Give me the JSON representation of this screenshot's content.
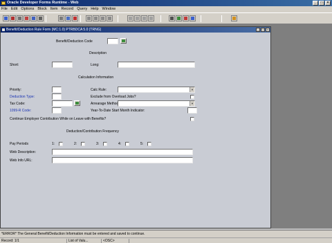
{
  "window": {
    "title": "Oracle Developer Forms Runtime - Web",
    "controls": [
      "_",
      "□",
      "×"
    ]
  },
  "menu": {
    "items": [
      "File",
      "Edit",
      "Options",
      "Block",
      "Item",
      "Record",
      "Query",
      "Help",
      "Window"
    ]
  },
  "toolbar": {
    "buttons": [
      {
        "icon": "save-icon",
        "color": "#3a5fcd"
      },
      {
        "icon": "exit-icon",
        "color": "#b03030"
      },
      {
        "icon": "print-icon",
        "color": "#707070"
      },
      {
        "icon": "cut-icon",
        "color": "#c04040"
      },
      {
        "icon": "copy-icon",
        "color": "#4060c0"
      },
      {
        "icon": "paste-icon",
        "color": "#606060"
      },
      {
        "icon": "enter-query-icon",
        "color": "#7a7a7a"
      },
      {
        "icon": "execute-query-icon",
        "color": "#4a6fc4"
      },
      {
        "icon": "cancel-query-icon",
        "color": "#c03030"
      },
      {
        "icon": "first-record-icon",
        "color": "#8a8a8a"
      },
      {
        "icon": "previous-record-icon",
        "color": "#8a8a8a"
      },
      {
        "icon": "next-record-icon",
        "color": "#8a8a8a"
      },
      {
        "icon": "last-record-icon",
        "color": "#8a8a8a"
      },
      {
        "icon": "insert-record-icon",
        "color": "#a0a0a0"
      },
      {
        "icon": "delete-record-icon",
        "color": "#a0a0a0"
      },
      {
        "icon": "clear-record-icon",
        "color": "#a0a0a0"
      },
      {
        "icon": "lock-record-icon",
        "color": "#a0a0a0"
      },
      {
        "icon": "edit-icon",
        "color": "#505050"
      },
      {
        "icon": "list-of-values-icon",
        "color": "#3a8a3a"
      },
      {
        "icon": "display-list-icon",
        "color": "#c03a3a"
      },
      {
        "icon": "help-icon",
        "color": "#3a5fcd"
      },
      {
        "icon": "window-icon",
        "color": "#d09020"
      }
    ]
  },
  "form": {
    "title": "Benefit/Deduction Rule Form (MC:1.0)  PTRBDCA  5.0  (TRNG)",
    "controls": [
      "_",
      "□",
      "×"
    ],
    "benefit_code_label": "Benefit/Deduction Code",
    "description_header": "Description",
    "short_label": "Short:",
    "long_label": "Long:",
    "calc_header": "Calculation Information",
    "priority_label": "Priority:",
    "deduction_type_label": "Deduction Type:",
    "tax_code_label": "Tax Code:",
    "form_1099r_label": "1099-R Code:",
    "calc_rule_label": "Calc Rule:",
    "exclude_overload_label": "Exclude from Overload Jobs?",
    "arrearage_label": "Arrearage Method:",
    "ytd_start_label": "Year-To-Date Start Month Indicator:",
    "continue_employer_label": "Continue Employer Contribution While on Leave with Benefits?",
    "frequency_header": "Deduction/Contribution Frequency",
    "pay_periods_label": "Pay Periods",
    "periods": [
      "1:",
      "2:",
      "3:",
      "4:",
      "5:"
    ],
    "web_description_label": "Web Description:",
    "web_info_url_label": "Web Info URL:"
  },
  "status": {
    "error_message": "*ERROR* The General Benefit/Deduction Information must be entered and saved to continue.",
    "record": "Record: 1/1",
    "list_of_values": "List of Valu...",
    "osc": "<OSC>"
  }
}
